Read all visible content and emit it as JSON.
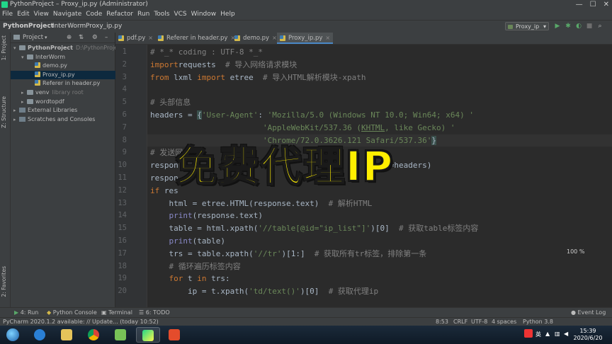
{
  "window": {
    "title": "PythonProject – Proxy_ip.py (Administrator)",
    "controls": [
      "—",
      "☐",
      "✕"
    ]
  },
  "menu": [
    "File",
    "Edit",
    "View",
    "Navigate",
    "Code",
    "Refactor",
    "Run",
    "Tools",
    "VCS",
    "Window",
    "Help"
  ],
  "breadcrumb": [
    "PythonProject",
    "InterWorm",
    "Proxy_ip.py"
  ],
  "run_config": "Proxy_ip",
  "project_panel": {
    "title": "Project",
    "tree": [
      {
        "label": "PythonProject",
        "hint": "D:\\PythonProject",
        "depth": 0,
        "kind": "folder",
        "open": true
      },
      {
        "label": "InterWorm",
        "depth": 1,
        "kind": "folder",
        "open": true
      },
      {
        "label": "demo.py",
        "depth": 2,
        "kind": "py"
      },
      {
        "label": "Proxy_ip.py",
        "depth": 2,
        "kind": "py",
        "selected": true
      },
      {
        "label": "Referer in header.py",
        "depth": 2,
        "kind": "py"
      },
      {
        "label": "venv",
        "hint": "library root",
        "depth": 1,
        "kind": "folder"
      },
      {
        "label": "wordtopdf",
        "depth": 1,
        "kind": "folder"
      },
      {
        "label": "External Libraries",
        "depth": 0,
        "kind": "lib"
      },
      {
        "label": "Scratches and Consoles",
        "depth": 0,
        "kind": "lib"
      }
    ]
  },
  "side_tabs": {
    "project": "1: Project",
    "structure": "Z: Structure",
    "favorites": "2: Favorites"
  },
  "tabs": [
    {
      "label": "pdf.py",
      "active": false
    },
    {
      "label": "Referer in header.py",
      "active": false
    },
    {
      "label": "demo.py",
      "active": false
    },
    {
      "label": "Proxy_ip.py",
      "active": true
    }
  ],
  "editor": {
    "current_line": 8,
    "line_numbers": [
      "1",
      "2",
      "3",
      "4",
      "5",
      "6",
      "7",
      "8",
      "9",
      "10",
      "11",
      "12",
      "13",
      "14",
      "15",
      "16",
      "17",
      "18",
      "19",
      "20"
    ],
    "lines": [
      [
        [
          "cmt",
          "# *_* coding : UTF-8 *_*"
        ]
      ],
      [
        [
          "kw",
          "import"
        ],
        [
          "",
          "requests  "
        ],
        [
          "cmt",
          "# 导入网络请求模块"
        ]
      ],
      [
        [
          "kw",
          "from"
        ],
        [
          "",
          " lxml "
        ],
        [
          "kw",
          "import"
        ],
        [
          "",
          " etree  "
        ],
        [
          "cmt",
          "# 导入HTML解析模块-xpath"
        ]
      ],
      [],
      [
        [
          "cmt",
          "# 头部信息"
        ]
      ],
      [
        [
          "",
          "headers = "
        ],
        [
          "hl",
          "{"
        ],
        [
          "str",
          "'User-Agent'"
        ],
        [
          "",
          ": "
        ],
        [
          "str",
          "'Mozilla/5.0 (Windows NT 10.0; Win64; x64) '"
        ]
      ],
      [
        [
          "",
          "                        "
        ],
        [
          "str",
          "'AppleWebKit/537.36 ("
        ],
        [
          "strul",
          "KHTML"
        ],
        [
          "str",
          ", like Gecko) '"
        ]
      ],
      [
        [
          "",
          "                        "
        ],
        [
          "str",
          "'Chrome/72.0.3626.121 Safari/537.36'"
        ],
        [
          "hl",
          "}"
        ]
      ],
      [
        [
          "cmt",
          "# 发送网"
        ]
      ],
      [
        [
          "",
          "respon"
        ],
        [
          "",
          ""
        ],
        [
          "",
          "                                        "
        ],
        [
          "",
          "aders=headers)"
        ]
      ],
      [
        [
          "",
          "respon"
        ]
      ],
      [
        [
          "kw",
          "if"
        ],
        [
          "",
          " res"
        ]
      ],
      [
        [
          "",
          "    html = etree.HTML(response.text)  "
        ],
        [
          "cmt",
          "# 解析HTML"
        ]
      ],
      [
        [
          "",
          "    "
        ],
        [
          "fn",
          "print"
        ],
        [
          "",
          "(response.text)"
        ]
      ],
      [
        [
          "",
          "    table = html.xpath("
        ],
        [
          "str",
          "'//table[@id=\"ip_list\"]'"
        ],
        [
          "",
          ")[0]  "
        ],
        [
          "cmt",
          "# 获取table标签内容"
        ]
      ],
      [
        [
          "",
          "    "
        ],
        [
          "fn",
          "print"
        ],
        [
          "",
          "(table)"
        ]
      ],
      [
        [
          "",
          "    trs = table.xpath("
        ],
        [
          "str",
          "'//tr'"
        ],
        [
          "",
          ")[1:]  "
        ],
        [
          "cmt",
          "# 获取所有tr标签，排除第一条"
        ]
      ],
      [
        [
          "",
          "    "
        ],
        [
          "cmt",
          "# 循环遍历标签内容"
        ]
      ],
      [
        [
          "",
          "    "
        ],
        [
          "kw",
          "for"
        ],
        [
          "",
          " t "
        ],
        [
          "kw",
          "in"
        ],
        [
          "",
          " trs:"
        ]
      ],
      [
        [
          "",
          "        ip = t.xpath("
        ],
        [
          "str",
          "'td/text()'"
        ],
        [
          "",
          ")[0]  "
        ],
        [
          "cmt",
          "# 获取代理ip"
        ]
      ]
    ]
  },
  "overlay_text": "免费代理IP",
  "zoom": "100 %",
  "toolwindows": [
    "4: Run",
    "Python Console",
    "Terminal",
    "6: TODO"
  ],
  "event_log": "Event Log",
  "status": {
    "message": "PyCharm 2020.1.2 available: // Update... (today 10:52)",
    "position": "8:53",
    "line_sep": "CRLF",
    "encoding": "UTF-8",
    "indent": "4 spaces",
    "interpreter": "Python 3.8"
  },
  "taskbar": {
    "time": "15:39",
    "date": "2020/6/20",
    "ime": "英"
  }
}
